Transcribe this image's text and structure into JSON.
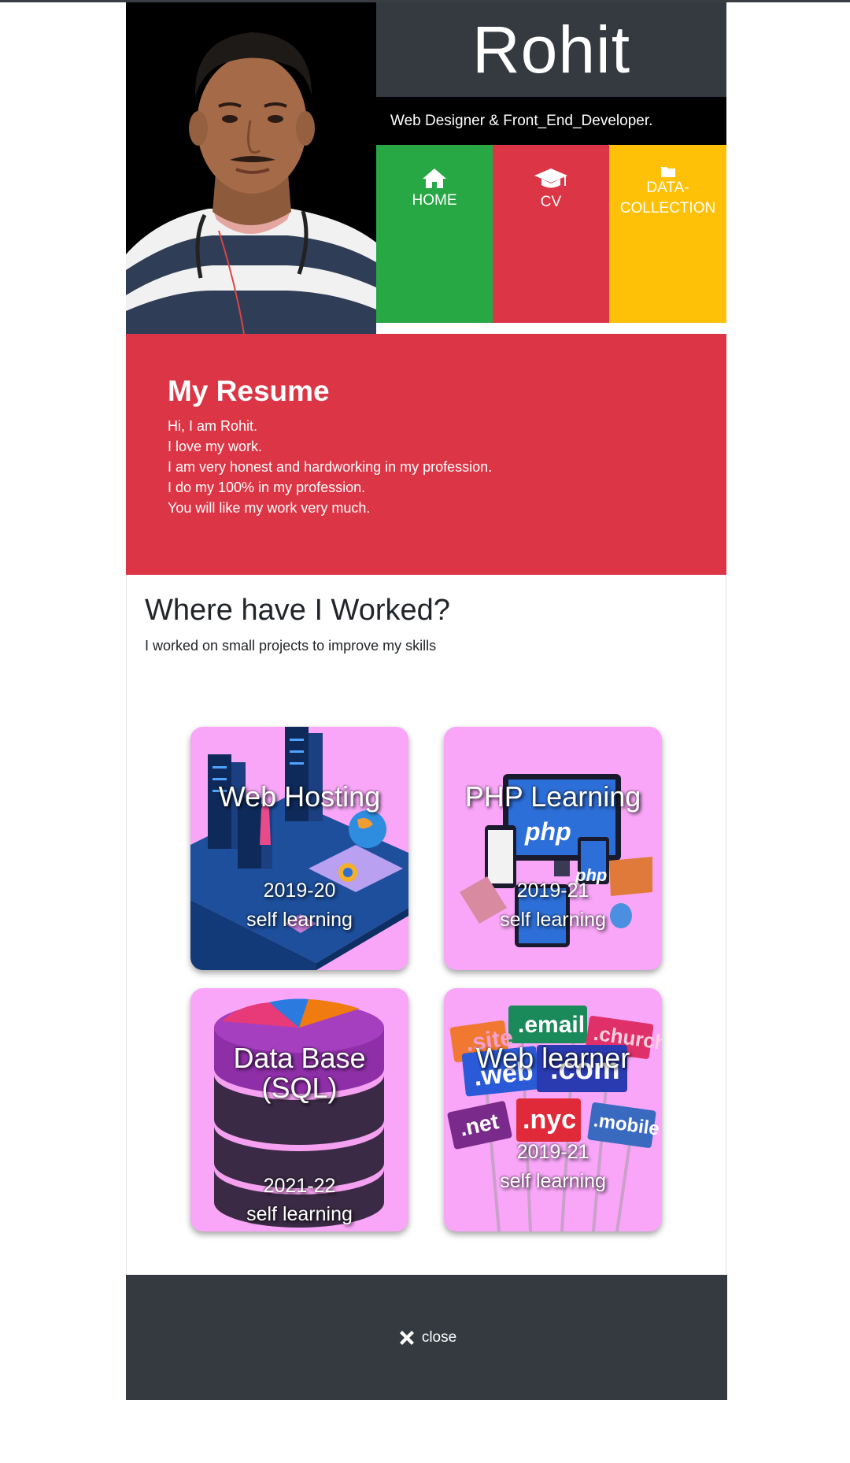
{
  "header": {
    "name": "Rohit",
    "tagline": "Web Designer & Front_End_Developer."
  },
  "nav": [
    {
      "label": "HOME",
      "icon": "home-icon",
      "color": "#28a745"
    },
    {
      "label": "CV",
      "icon": "graduation-cap-icon",
      "color": "#dc3545"
    },
    {
      "label_line1": "DATA-",
      "label_line2": "COLLECTION",
      "icon": "folder-icon",
      "color": "#ffc107"
    }
  ],
  "resume": {
    "title": "My Resume",
    "lines": [
      "Hi, I am Rohit.",
      "I love my work.",
      "I am very honest and hardworking in my profession.",
      "I do my 100% in my profession.",
      "You will like my work very much."
    ]
  },
  "worked": {
    "title": "Where have I Worked?",
    "subtitle": "I worked on small projects to improve my skills",
    "cards": [
      {
        "title": "Web Hosting",
        "year": "2019-20",
        "mode": "self learning"
      },
      {
        "title": "PHP Learning",
        "year": "2019-21",
        "mode": "self learning"
      },
      {
        "title_line1": "Data Base",
        "title_line2": "(SQL)",
        "year": "2021-22",
        "mode": "self learning"
      },
      {
        "title": "Web learner",
        "year": "2019-21",
        "mode": "self learning",
        "tags": [
          ".site",
          ".email",
          ".church",
          ".web",
          ".com",
          ".net",
          ".nyc",
          ".mobile"
        ]
      }
    ],
    "php_badges": [
      "php",
      "php"
    ]
  },
  "footer": {
    "close_label": "close",
    "icon": "close-icon"
  },
  "colors": {
    "dark": "#343a40",
    "green": "#28a745",
    "red": "#dc3545",
    "yellow": "#ffc107",
    "card_pink": "#f9a6f8"
  }
}
